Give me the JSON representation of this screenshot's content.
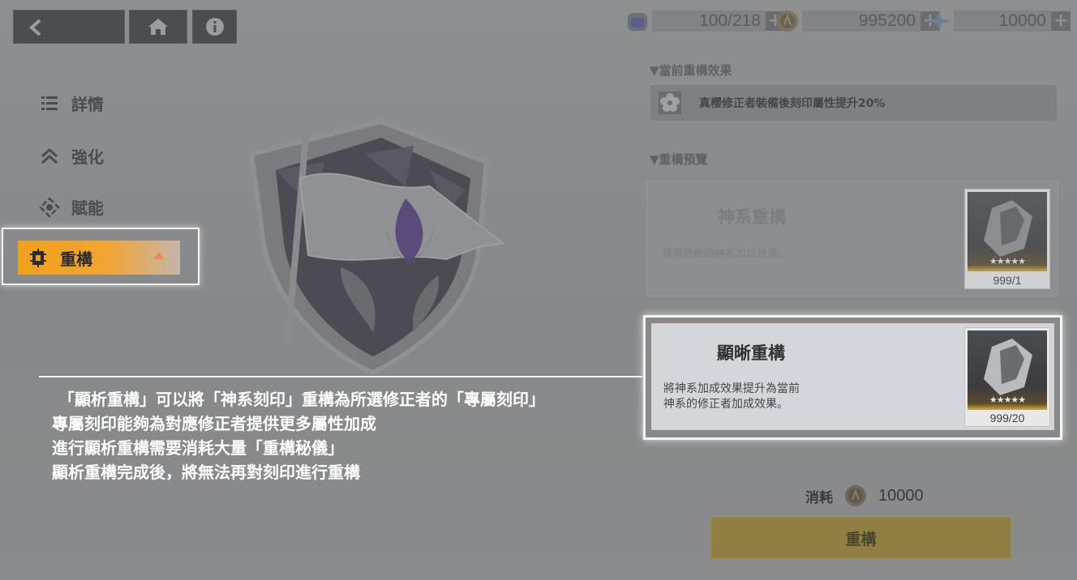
{
  "topbar": {
    "back_icon": "back-arrow-icon",
    "home_icon": "home-icon",
    "info_icon": "info-icon"
  },
  "resources": [
    {
      "name": "stamina",
      "value": "100/218",
      "plus": "+"
    },
    {
      "name": "coin",
      "value": "995200",
      "plus": "+"
    },
    {
      "name": "crystal",
      "value": "10000",
      "plus": "+"
    }
  ],
  "nav": {
    "items": [
      {
        "label": "詳情",
        "icon": "list-icon"
      },
      {
        "label": "強化",
        "icon": "double-chevron-up-icon"
      },
      {
        "label": "賦能",
        "icon": "empower-icon"
      }
    ],
    "active": {
      "label": "重構",
      "icon": "reconstruct-icon",
      "accent": "#f0a21a"
    }
  },
  "current_effect": {
    "title": "▼當前重構效果",
    "text": "真櫻修正者裝備後刻印屬性提升20%"
  },
  "preview": {
    "title": "▼重構預覽",
    "options": [
      {
        "title": "神系重構",
        "desc": "獲得隨機的神系加成效果。",
        "count": "999/1",
        "stars": "★★★★★"
      },
      {
        "title": "顯晰重構",
        "desc_lines": [
          "將神系加成效果提升為當前",
          "神系的修正者加成效果。"
        ],
        "count": "999/20",
        "stars": "★★★★★"
      }
    ]
  },
  "tooltip": {
    "lines": [
      "「顯析重構」可以將「神系刻印」重構為所選修正者的「專屬刻印」",
      "專屬刻印能夠為對應修正者提供更多屬性加成",
      "進行顯析重構需要消耗大量「重構秘儀」",
      "顯析重構完成後，將無法再對刻印進行重構"
    ]
  },
  "cost": {
    "label": "消耗",
    "value": "10000"
  },
  "action_button": {
    "label": "重構"
  }
}
